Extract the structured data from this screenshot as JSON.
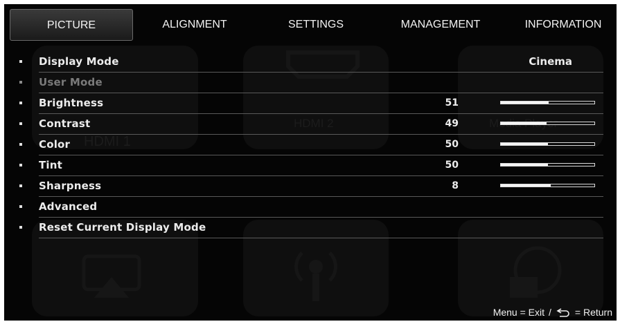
{
  "tabs": [
    {
      "label": "PICTURE",
      "active": true
    },
    {
      "label": "ALIGNMENT",
      "active": false
    },
    {
      "label": "SETTINGS",
      "active": false
    },
    {
      "label": "MANAGEMENT",
      "active": false
    },
    {
      "label": "INFORMATION",
      "active": false
    }
  ],
  "background_tiles": {
    "hdmi1": "HDMI 1",
    "hdmi2": "HDMI 2",
    "media": "Media Player"
  },
  "rows": [
    {
      "label": "Display Mode",
      "value": "Cinema",
      "disabled": false
    },
    {
      "label": "User Mode",
      "disabled": true
    },
    {
      "label": "Brightness",
      "number": "51",
      "level": 0.51
    },
    {
      "label": "Contrast",
      "number": "49",
      "level": 0.49
    },
    {
      "label": "Color",
      "number": "50",
      "level": 0.5
    },
    {
      "label": "Tint",
      "number": "50",
      "level": 0.5
    },
    {
      "label": "Sharpness",
      "number": "8",
      "level": 0.53
    },
    {
      "label": "Advanced"
    },
    {
      "label": "Reset Current Display Mode"
    }
  ],
  "footer": {
    "exit": "Menu = Exit",
    "sep": "/",
    "return": "= Return"
  },
  "icons": {
    "return": "return-arrow-icon",
    "bullet": "bullet-icon"
  },
  "colors": {
    "background": "#050505",
    "text": "#ececec",
    "disabled": "#7a7a7a",
    "divider": "#5a5a5a"
  }
}
